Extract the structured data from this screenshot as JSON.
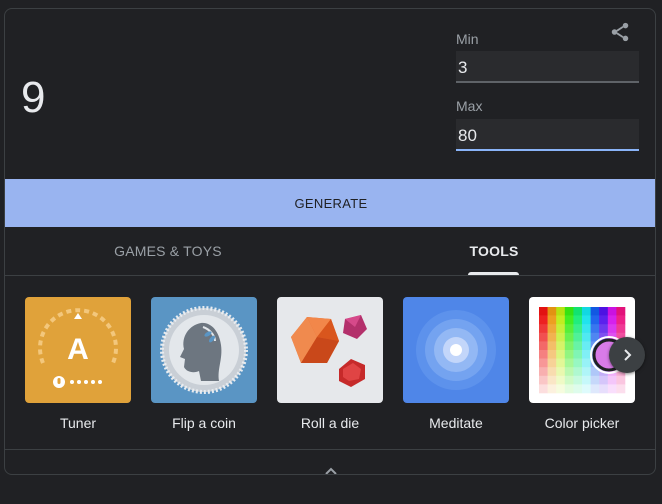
{
  "result": {
    "value": "9"
  },
  "min": {
    "label": "Min",
    "value": "3"
  },
  "max": {
    "label": "Max",
    "value": "80"
  },
  "generate_label": "GENERATE",
  "tabs": [
    {
      "label": "GAMES & TOYS",
      "selected": false
    },
    {
      "label": "TOOLS",
      "selected": true
    }
  ],
  "tools": [
    {
      "label": "Tuner",
      "icon": "tuner-icon",
      "tile_letter": "A"
    },
    {
      "label": "Flip a coin",
      "icon": "coin-icon"
    },
    {
      "label": "Roll a die",
      "icon": "dice-icon"
    },
    {
      "label": "Meditate",
      "icon": "meditate-icon"
    },
    {
      "label": "Color picker",
      "icon": "color-picker-icon"
    }
  ],
  "colors": {
    "accent": "#8ab4f8",
    "generate_bg": "#99b4f0",
    "tuner_bg": "#e0a23a",
    "coin_bg": "#5a95c4",
    "meditate_bg": "#4f86e8"
  }
}
